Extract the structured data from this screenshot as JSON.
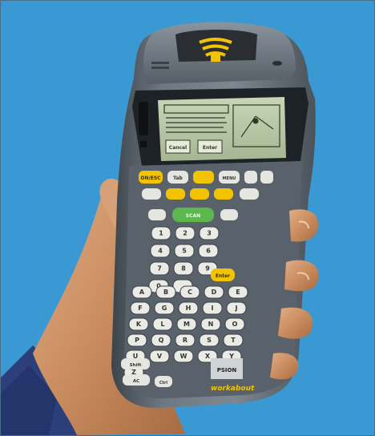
{
  "photo": {
    "background_color": "#3e9fd8",
    "device_body_color": "#6c7680",
    "screen_color": "#b9c9a6"
  },
  "device": {
    "brand_label": "workabout",
    "badge_label": "PSION",
    "scan_key_label": "SCAN",
    "enter_key_label": "Enter",
    "on_key_label": "ON/ESC",
    "tab_key_label": "Tab",
    "menu_key_label": "MENU",
    "shift_key_label": "Shift",
    "ctrl_key_label": "Ctrl",
    "ac_key_label": "AC",
    "screen_softkeys": [
      "Cancel",
      "Enter"
    ]
  },
  "keypad": {
    "alpha_rows": [
      [
        "A",
        "B",
        "C",
        "D",
        "E"
      ],
      [
        "F",
        "G",
        "H",
        "I",
        "J"
      ],
      [
        "K",
        "L",
        "M",
        "N",
        "O"
      ],
      [
        "P",
        "Q",
        "R",
        "S",
        "T"
      ],
      [
        "U",
        "V",
        "W",
        "X",
        "Y"
      ],
      [
        "Z"
      ]
    ],
    "numeric_rows": [
      [
        "1",
        "2",
        "3"
      ],
      [
        "4",
        "5",
        "6"
      ],
      [
        "7",
        "8",
        "9"
      ],
      [
        "0",
        "."
      ]
    ]
  }
}
